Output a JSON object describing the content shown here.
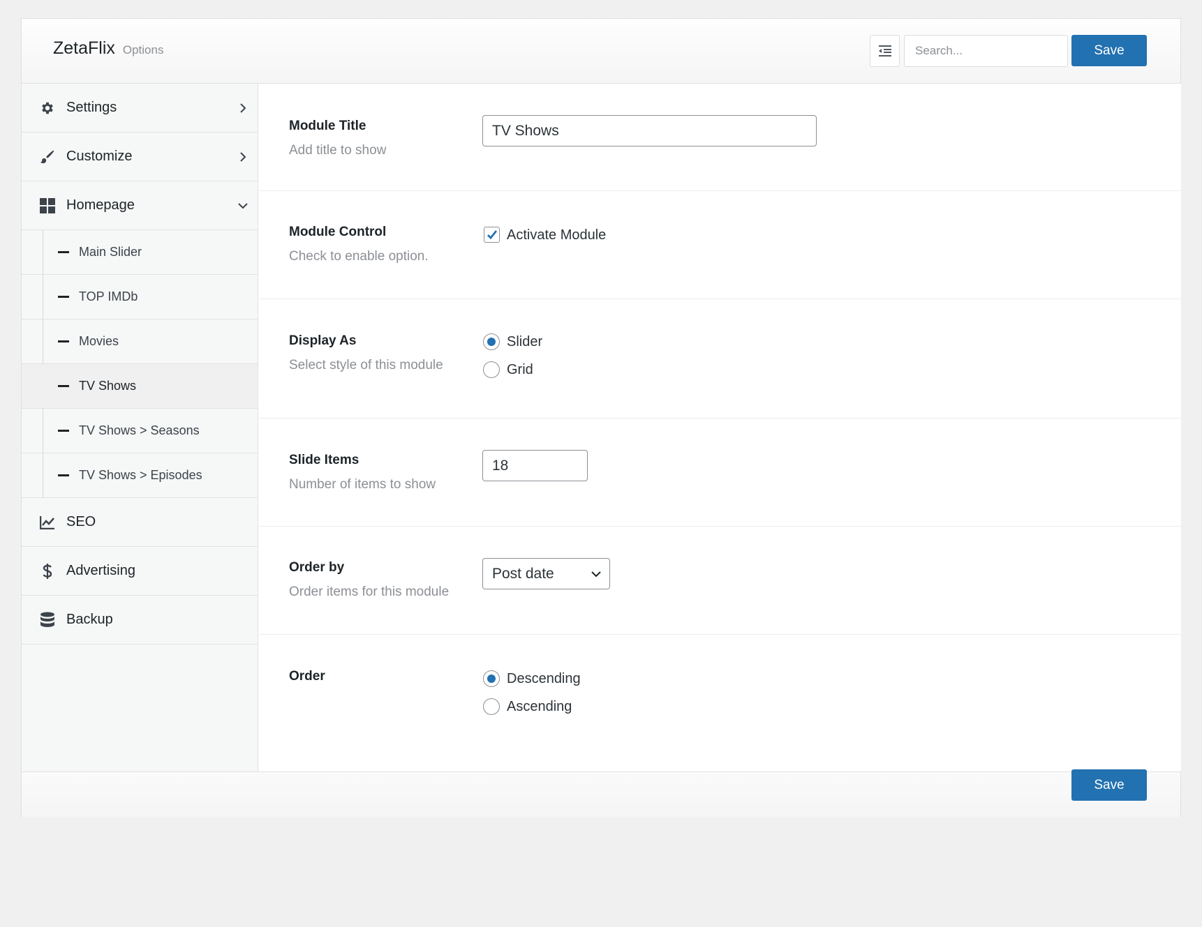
{
  "header": {
    "brand": "ZetaFlix",
    "brand_sub": "Options",
    "search_placeholder": "Search...",
    "save_label": "Save",
    "expand_icon": "collapse-indent-icon"
  },
  "sidebar": {
    "items": [
      {
        "label": "Settings",
        "icon": "gear-icon",
        "state": "collapsed"
      },
      {
        "label": "Customize",
        "icon": "brush-icon",
        "state": "collapsed"
      },
      {
        "label": "Homepage",
        "icon": "grid-icon",
        "state": "expanded"
      },
      {
        "label": "SEO",
        "icon": "chart-icon"
      },
      {
        "label": "Advertising",
        "icon": "dollar-icon"
      },
      {
        "label": "Backup",
        "icon": "database-icon"
      }
    ],
    "homepage_sub": [
      {
        "label": "Main Slider"
      },
      {
        "label": "TOP IMDb"
      },
      {
        "label": "Movies"
      },
      {
        "label": "TV Shows",
        "active": true
      },
      {
        "label": "TV Shows > Seasons"
      },
      {
        "label": "TV Shows > Episodes"
      }
    ]
  },
  "fields": {
    "module_title": {
      "title": "Module Title",
      "desc": "Add title to show",
      "value": "TV Shows"
    },
    "module_control": {
      "title": "Module Control",
      "desc": "Check to enable option.",
      "checkbox_label": "Activate Module",
      "checked": true
    },
    "display_as": {
      "title": "Display As",
      "desc": "Select style of this module",
      "options": [
        "Slider",
        "Grid"
      ],
      "selected": "Slider"
    },
    "slide_items": {
      "title": "Slide Items",
      "desc": "Number of items to show",
      "value": "18"
    },
    "order_by": {
      "title": "Order by",
      "desc": "Order items for this module",
      "selected": "Post date"
    },
    "order": {
      "title": "Order",
      "options": [
        "Descending",
        "Ascending"
      ],
      "selected": "Descending"
    }
  },
  "footer": {
    "save_label": "Save"
  },
  "colors": {
    "accent": "#2271b1",
    "muted": "#8c8f94"
  }
}
